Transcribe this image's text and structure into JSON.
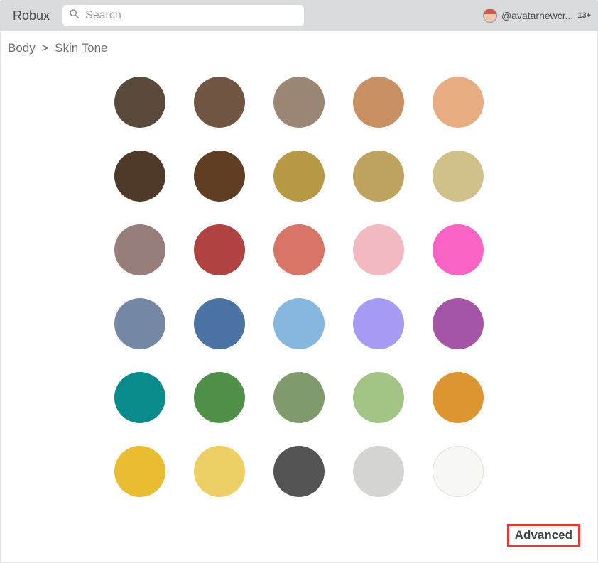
{
  "topbar": {
    "robux_label": "Robux",
    "search_placeholder": "Search",
    "username": "@avatarnewcr...",
    "age_badge": "13+"
  },
  "breadcrumb": {
    "body": "Body",
    "sep": ">",
    "skinTone": "Skin Tone"
  },
  "swatches": [
    {
      "name": "dark-taupe",
      "color": "#5a4a3c"
    },
    {
      "name": "medium-brown",
      "color": "#6f5542"
    },
    {
      "name": "warm-taupe",
      "color": "#9a8672"
    },
    {
      "name": "sandy-tan",
      "color": "#c78f62"
    },
    {
      "name": "light-peach",
      "color": "#e8ac83"
    },
    {
      "name": "espresso",
      "color": "#4f3928"
    },
    {
      "name": "chocolate",
      "color": "#5f3e24"
    },
    {
      "name": "dark-gold",
      "color": "#b79845"
    },
    {
      "name": "olive-gold",
      "color": "#bda35e"
    },
    {
      "name": "pale-khaki",
      "color": "#d0c18b"
    },
    {
      "name": "mauve-taupe",
      "color": "#977e7a"
    },
    {
      "name": "brick-red",
      "color": "#b04242"
    },
    {
      "name": "salmon",
      "color": "#d87567"
    },
    {
      "name": "pale-pink",
      "color": "#f3b9c1"
    },
    {
      "name": "hot-pink",
      "color": "#f963c5"
    },
    {
      "name": "slate-blue",
      "color": "#7488a5"
    },
    {
      "name": "medium-blue",
      "color": "#4a73a3"
    },
    {
      "name": "sky-blue",
      "color": "#86b7df"
    },
    {
      "name": "periwinkle",
      "color": "#a59bf3"
    },
    {
      "name": "orchid",
      "color": "#a555a6"
    },
    {
      "name": "teal",
      "color": "#0a8b8b"
    },
    {
      "name": "forest-green",
      "color": "#4f8f47"
    },
    {
      "name": "sage-green",
      "color": "#809a6e"
    },
    {
      "name": "light-sage",
      "color": "#a2c585"
    },
    {
      "name": "orange-amber",
      "color": "#dc9531"
    },
    {
      "name": "goldenrod",
      "color": "#eabc32"
    },
    {
      "name": "pale-yellow",
      "color": "#eecf66"
    },
    {
      "name": "charcoal",
      "color": "#545454"
    },
    {
      "name": "light-gray",
      "color": "#d4d4d2"
    },
    {
      "name": "off-white",
      "color": "#f7f7f4"
    }
  ],
  "advanced_label": "Advanced"
}
